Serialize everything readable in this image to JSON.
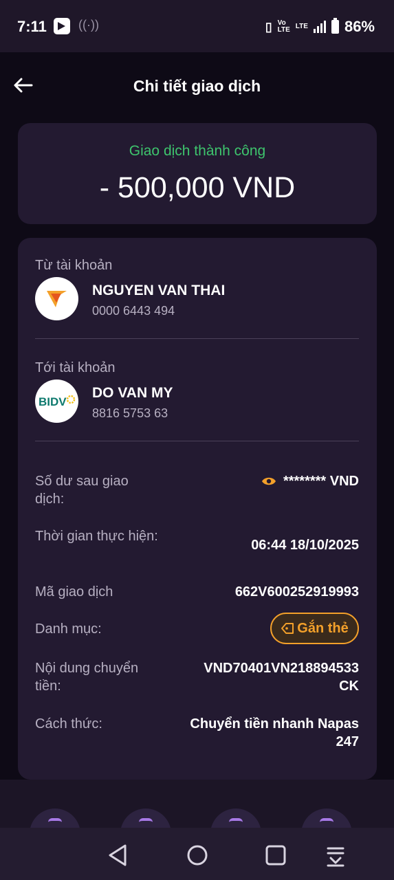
{
  "status_bar": {
    "time": "7:11",
    "battery": "86%",
    "volte_top": "Vo",
    "volte_bottom": "LTE",
    "lte_label": "LTE"
  },
  "header": {
    "title": "Chi tiết giao dịch"
  },
  "summary": {
    "status": "Giao dịch thành công",
    "amount": "- 500,000 VND",
    "status_color": "#3ec46d"
  },
  "from_account": {
    "label": "Từ tài khoản",
    "name": "NGUYEN VAN THAI",
    "number": "0000 6443 494"
  },
  "to_account": {
    "label": "Tới tài khoản",
    "name": "DO VAN MY",
    "number": "8816 5753 63",
    "bank_logo_text": "BIDV"
  },
  "details": {
    "balance_label": "Số dư sau giao dịch:",
    "balance_value": "******** VND",
    "time_label": "Thời gian thực hiện:",
    "time_value": "06:44 18/10/2025",
    "txn_code_label": "Mã giao dịch",
    "txn_code_value": "662V600252919993",
    "category_label": "Danh mục:",
    "tag_button": "Gắn thẻ",
    "content_label": "Nội dung chuyển tiền:",
    "content_value": "VND70401VN218894533 CK",
    "method_label": "Cách thức:",
    "method_value": "Chuyển tiền nhanh Napas 247"
  },
  "colors": {
    "accent_orange": "#f3a02a",
    "background": "#0e0a16",
    "card": "#231a31"
  }
}
